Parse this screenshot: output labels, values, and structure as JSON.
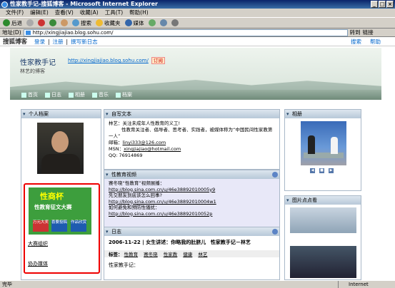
{
  "window": {
    "title": "性家教手记-搜狐博客 - Microsoft Internet Explorer"
  },
  "menu": [
    "文件(F)",
    "编辑(E)",
    "查看(V)",
    "收藏(A)",
    "工具(T)",
    "帮助(H)"
  ],
  "toolbar": {
    "back": "后退",
    "search": "搜索",
    "favorites": "收藏夹",
    "media": "媒体"
  },
  "address": {
    "label": "地址(D)",
    "url": "http://xingjiajiao.blog.sohu.com/",
    "go": "转到",
    "links": "链接"
  },
  "sohubar": {
    "logo": "搜狐博客",
    "login": "登录",
    "register": "注册",
    "write": "撰写新日志",
    "search": "搜索",
    "help": "帮助"
  },
  "banner": {
    "title": "性家教手记",
    "url": "http://xingjiajiao.blog.sohu.com/",
    "rss": "订阅",
    "subtitle": "林艺的博客"
  },
  "nav": [
    {
      "label": "首页"
    },
    {
      "label": "日志"
    },
    {
      "label": "相册"
    },
    {
      "label": "音乐"
    },
    {
      "label": "档案"
    }
  ],
  "profile": {
    "title": "个人档案",
    "ad_big": "性商杯",
    "ad_mid": "性教育征文大赛",
    "ad_b1": "万元大奖",
    "ad_b2": "喜要投稿",
    "ad_b3": "作品欣赏",
    "link1": "大赛组织",
    "link2": "协办媒体"
  },
  "intro": {
    "title": "自写文本",
    "l1": "林艺：关注未成年人性教育的义工!",
    "l2": "性教育关注者、倡导者、思考者、实践者，被媒体称为“中国民间性家教第",
    "l3": "一人”",
    "email_label": "邮箱：",
    "email": "linyi333@126.com",
    "msn_label": "MSN：",
    "msn": "xingjiajiao@hotmail.com",
    "qq": "QQ: 76914869"
  },
  "video": {
    "title": "性教育视频",
    "l1": "赛冬晓“性教育”视频展播：",
    "u1": "http://blog.sina.com.cn/u/46e38892010005y9",
    "l2": "先交朋友到底该怎么回事?",
    "u2": "http://blog.sina.com.cn/u/46e38892010004w1",
    "l3": "如何避免和预防性骚扰：",
    "u3": "http://blog.sina.com.cn/u/46e38892010052p"
  },
  "diary": {
    "title": "日志",
    "date": "2006-11-22 | 女生讲述：你略我的肚脐儿",
    "author": "性家教手记－林艺",
    "tags_label": "标签：",
    "tags": [
      "性教育",
      "赛冬晓",
      "性家教",
      "健康",
      "林艺"
    ],
    "start": "性家教手记："
  },
  "album": {
    "title": "相册"
  },
  "pics": {
    "title": "图片点点看"
  },
  "status": {
    "left": "完毕",
    "right": "Internet"
  }
}
